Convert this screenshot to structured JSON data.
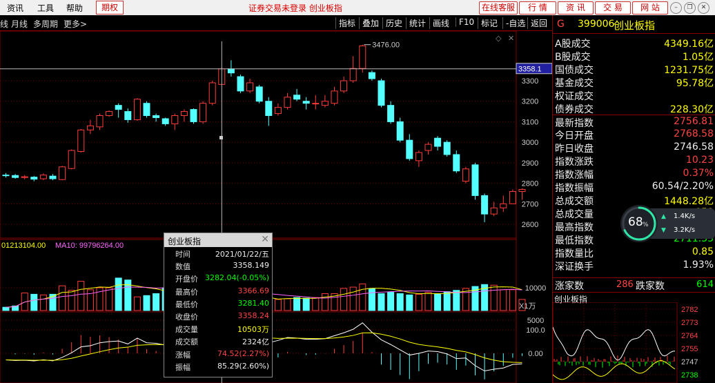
{
  "menu": {
    "items": [
      "资讯",
      "工具",
      "帮助"
    ],
    "futures": "期权"
  },
  "window_title": "证券交易未登录  创业板指",
  "right_buttons": [
    "在线客服",
    "行 情",
    "资 讯",
    "交 易",
    "网 站"
  ],
  "toolbar": {
    "left": [
      "线",
      "月线",
      "多周期",
      "更多>"
    ],
    "right": [
      "指标",
      "叠加",
      "历史",
      "统计",
      "画线",
      "F10",
      "标记",
      "-自选",
      "返回"
    ]
  },
  "chart_data": [
    {
      "type": "candlestick",
      "title": "",
      "y_ticks": [
        2600,
        2700,
        2800,
        2900,
        3000,
        3100,
        3200,
        3300
      ],
      "ylim": [
        2540,
        3560
      ],
      "current_price_label": "3358.1",
      "high_annotation": "3476.00",
      "candles": [
        [
          2840,
          2838,
          2850,
          2828
        ],
        [
          2838,
          2828,
          2845,
          2822
        ],
        [
          2828,
          2832,
          2840,
          2820
        ],
        [
          2830,
          2820,
          2835,
          2810
        ],
        [
          2822,
          2840,
          2848,
          2815
        ],
        [
          2835,
          2822,
          2845,
          2815
        ],
        [
          2818,
          2880,
          2885,
          2815
        ],
        [
          2872,
          2960,
          2965,
          2868
        ],
        [
          2955,
          3060,
          3065,
          2950
        ],
        [
          3060,
          3080,
          3110,
          3040
        ],
        [
          3075,
          3130,
          3140,
          3060
        ],
        [
          3130,
          3150,
          3155,
          3125
        ],
        [
          3180,
          3160,
          3190,
          3120
        ],
        [
          3150,
          3110,
          3165,
          3095
        ],
        [
          3110,
          3210,
          3215,
          3105
        ],
        [
          3190,
          3130,
          3200,
          3120
        ],
        [
          3130,
          3120,
          3140,
          3100
        ],
        [
          3115,
          3090,
          3120,
          3080
        ],
        [
          3090,
          3130,
          3140,
          3060
        ],
        [
          3130,
          3150,
          3160,
          3100
        ],
        [
          3160,
          3100,
          3165,
          3090
        ],
        [
          3100,
          3190,
          3200,
          3090
        ],
        [
          3190,
          3290,
          3300,
          3180
        ],
        [
          3282,
          3358,
          3367,
          3281
        ],
        [
          3358,
          3338,
          3400,
          3320
        ],
        [
          3320,
          3250,
          3330,
          3240
        ],
        [
          3250,
          3290,
          3310,
          3240
        ],
        [
          3270,
          3200,
          3280,
          3190
        ],
        [
          3200,
          3130,
          3220,
          3080
        ],
        [
          3140,
          3170,
          3190,
          3130
        ],
        [
          3170,
          3220,
          3240,
          3160
        ],
        [
          3230,
          3210,
          3260,
          3200
        ],
        [
          3200,
          3190,
          3220,
          3160
        ],
        [
          3190,
          3190,
          3230,
          3160
        ],
        [
          3180,
          3200,
          3230,
          3170
        ],
        [
          3190,
          3250,
          3270,
          3180
        ],
        [
          3250,
          3300,
          3320,
          3240
        ],
        [
          3300,
          3360,
          3420,
          3290
        ],
        [
          3360,
          3470,
          3476,
          3340
        ],
        [
          3340,
          3310,
          3350,
          3300
        ],
        [
          3300,
          3180,
          3310,
          3170
        ],
        [
          3180,
          3100,
          3200,
          3090
        ],
        [
          3100,
          3010,
          3120,
          3000
        ],
        [
          3010,
          2920,
          3040,
          2910
        ],
        [
          2910,
          2950,
          2960,
          2880
        ],
        [
          2960,
          2990,
          3000,
          2940
        ],
        [
          3020,
          2980,
          3030,
          2960
        ],
        [
          3000,
          2940,
          3010,
          2930
        ],
        [
          2940,
          2860,
          2960,
          2850
        ],
        [
          2810,
          2870,
          2880,
          2800
        ],
        [
          2890,
          2740,
          2900,
          2720
        ],
        [
          2740,
          2650,
          2750,
          2610
        ],
        [
          2650,
          2680,
          2710,
          2640
        ],
        [
          2680,
          2700,
          2740,
          2660
        ],
        [
          2700,
          2760,
          2770,
          2700
        ],
        [
          2760,
          2770,
          2775,
          2720
        ]
      ]
    },
    {
      "type": "bar",
      "title": "",
      "series_labels": [
        "01213104.00",
        "MA10: 99796264.00"
      ],
      "y_ticks": [
        5000,
        10000
      ],
      "unit_label": "X1万",
      "values": [
        7000,
        7200,
        9200,
        9000,
        8900,
        9000,
        10300,
        9600,
        11000,
        9700,
        10000,
        10000,
        11500,
        11200,
        8600,
        8800,
        9100,
        10000,
        9800,
        9400,
        9700,
        9600,
        9600,
        9900,
        9500,
        7900,
        8300,
        8500,
        8400,
        8200,
        8300,
        8500,
        8400,
        8500,
        9100,
        9100,
        9900,
        10100,
        10600,
        9900,
        9100,
        9300,
        9100,
        8900,
        9000,
        9300,
        9100,
        9400,
        9600,
        9900,
        10200,
        10500,
        10400,
        9700,
        9700,
        8200
      ]
    },
    {
      "type": "line",
      "title": "",
      "y_ticks": [
        0.0,
        100.0
      ],
      "y_tick_labels": [
        "0.00",
        "100.0"
      ]
    }
  ],
  "right_panel": {
    "code": "G",
    "index_code": "399006",
    "index_name": "创业板指",
    "rows": [
      {
        "label": "A股成交",
        "value": "4349.16亿",
        "color": "yel"
      },
      {
        "label": "B股成交",
        "value": "1.05亿",
        "color": "yel"
      },
      {
        "label": "国债成交",
        "value": "1231.75亿",
        "color": "yel"
      },
      {
        "label": "基金成交",
        "value": "95.78亿",
        "color": "yel"
      },
      {
        "label": "权证成交",
        "value": "",
        "color": "yel"
      },
      {
        "label": "债券成交",
        "value": "228.30亿",
        "color": "yel"
      },
      {
        "label": "最新指数",
        "value": "2756.81",
        "color": "red"
      },
      {
        "label": "今日开盘",
        "value": "2768.58",
        "color": "red"
      },
      {
        "label": "昨日收盘",
        "value": "2746.58",
        "color": "wht"
      },
      {
        "label": "指数涨跌",
        "value": "10.23",
        "color": "red"
      },
      {
        "label": "指数涨幅",
        "value": "0.37%",
        "color": "red"
      },
      {
        "label": "指数振幅",
        "value": "60.54/2.20%",
        "color": "wht"
      },
      {
        "label": "总成交额",
        "value": "1448.28亿",
        "color": "yel"
      },
      {
        "label": "总成交量",
        "value": "059",
        "color": "yel"
      },
      {
        "label": "最高指数",
        "value": "87",
        "color": "red"
      },
      {
        "label": "最低指数",
        "value": "2711.33",
        "color": "grn"
      },
      {
        "label": "指数量比",
        "value": "0.85",
        "color": "yel"
      },
      {
        "label": "深证换手",
        "value": "1.93%",
        "color": "wht"
      }
    ],
    "up_label": "涨家数",
    "up_count": "286",
    "down_label": "跌家数",
    "down_count": "614",
    "mini_title": "创业板指",
    "mini_ticks": [
      "2782",
      "2773",
      "2764",
      "2755",
      "2747",
      "2738"
    ]
  },
  "gauge": {
    "percent": "68",
    "unit": "%",
    "up_speed": "1.4K/s",
    "down_speed": "3.2K/s"
  },
  "popup": {
    "title": "创业板指",
    "rows": [
      {
        "label": "时间",
        "value": "2021/01/22/五",
        "color": "wht"
      },
      {
        "label": "数值",
        "value": "3358.149",
        "color": "wht"
      },
      {
        "label": "开盘价",
        "value": "3282.04(-0.05%)",
        "color": "grn"
      },
      {
        "label": "最高价",
        "value": "3366.69",
        "color": "red"
      },
      {
        "label": "最低价",
        "value": "3281.40",
        "color": "grn"
      },
      {
        "label": "收盘价",
        "value": "3358.24",
        "color": "red"
      },
      {
        "label": "成交量",
        "value": "10503万",
        "color": "yel"
      },
      {
        "label": "成交额",
        "value": "2324亿",
        "color": "wht"
      },
      {
        "label": "涨幅",
        "value": "74.52(2.27%)",
        "color": "red"
      },
      {
        "label": "振幅",
        "value": "85.29(2.60%)",
        "color": "wht"
      }
    ]
  },
  "colors": {
    "up": "#ff3c3c",
    "down": "#54ffff",
    "ma_yellow": "#ffff00",
    "ma_pink": "#ff66ff",
    "grid": "#800000"
  }
}
